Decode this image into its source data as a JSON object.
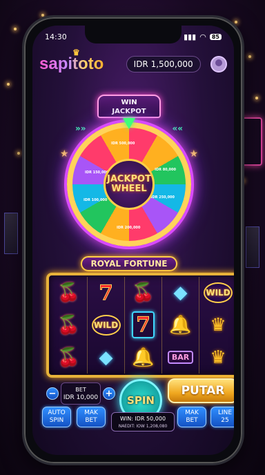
{
  "status_bar": {
    "time": "14:30",
    "battery": "85"
  },
  "header": {
    "logo_text": "sapitoto",
    "balance": "IDR 1,500,000"
  },
  "wheel": {
    "banner_line1": "WIN",
    "banner_line2": "JACKPOT",
    "hub_line1": "JACKPOT",
    "hub_line2": "WHEEL",
    "segment_labels": [
      "IDR 150,000",
      "IDR 80,000",
      "IDR 250,000",
      "IDR 100,000",
      "IDR 500,000",
      "IDR 200,000"
    ]
  },
  "game": {
    "title": "ROYAL FORTUNE"
  },
  "reels": [
    [
      "cherry",
      "seven",
      "cherry",
      "diamond",
      "wild"
    ],
    [
      "cherry",
      "wild",
      "seven",
      "bell",
      "crown"
    ],
    [
      "cherry",
      "diamond",
      "bell",
      "bar",
      "crown"
    ]
  ],
  "symbols": {
    "wild_label": "WILD",
    "bar_label": "BAR",
    "seven_label": "7"
  },
  "controls": {
    "bet_label": "BET",
    "bet_value": "IDR 10,000",
    "minus": "−",
    "plus": "+",
    "spin_label": "SPIN",
    "putar_label": "PUTAR",
    "auto_spin_line1": "AUTO",
    "auto_spin_line2": "SPIN",
    "max_bet_left_line1": "MAK",
    "max_bet_left_line2": "BET",
    "max_bet_right_line1": "MAK",
    "max_bet_right_line2": "BET",
    "lines_line1": "LINE",
    "lines_line2": "25",
    "win_text": "WIN: IDR 50,000",
    "credit_text": "NAEDIT: IOW 1,208,080"
  },
  "colors": {
    "accent_gold": "#ffcf4a",
    "accent_pink": "#ff4fd2",
    "accent_blue": "#2f8fff"
  }
}
